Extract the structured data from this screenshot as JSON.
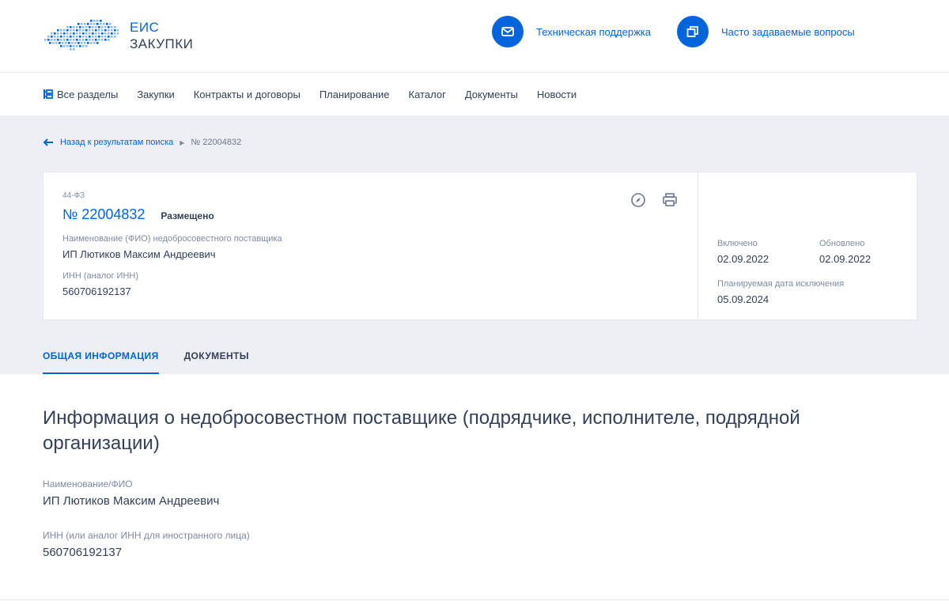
{
  "logo": {
    "line1": "ЕИС",
    "line2": "ЗАКУПКИ"
  },
  "header_links": [
    {
      "label": "Техническая поддержка",
      "icon": "mail-icon"
    },
    {
      "label": "Часто задаваемые вопросы",
      "icon": "windows-icon"
    }
  ],
  "nav": {
    "all_sections": "Все разделы",
    "items": [
      "Закупки",
      "Контракты и договоры",
      "Планирование",
      "Каталог",
      "Документы",
      "Новости"
    ]
  },
  "breadcrumb": {
    "back": "Назад к результатам поиска",
    "current": "№ 22004832"
  },
  "card": {
    "law": "44-ФЗ",
    "number": "№ 22004832",
    "status": "Размещено",
    "name_label": "Наименование (ФИО) недобросовестного поставщика",
    "name_value": "ИП Лютиков Максим Андреевич",
    "inn_label": "ИНН (аналог ИНН)",
    "inn_value": "560706192137",
    "included_label": "Включено",
    "included_value": "02.09.2022",
    "updated_label": "Обновлено",
    "updated_value": "02.09.2022",
    "planned_label": "Планируемая дата исключения",
    "planned_value": "05.09.2024"
  },
  "tabs": [
    "ОБЩАЯ ИНФОРМАЦИЯ",
    "ДОКУМЕНТЫ"
  ],
  "main": {
    "title": "Информация о недобросовестном поставщике (подрядчике, исполнителе, подрядной организации)",
    "name_label": "Наименование/ФИО",
    "name_value": "ИП Лютиков Максим Андреевич",
    "inn_label": "ИНН (или аналог ИНН для иностранного лица)",
    "inn_value": "560706192137"
  },
  "colors": {
    "accent": "#0065dd",
    "text": "#334059",
    "muted": "#7f8aa3",
    "gray_bg": "#edeff4"
  }
}
